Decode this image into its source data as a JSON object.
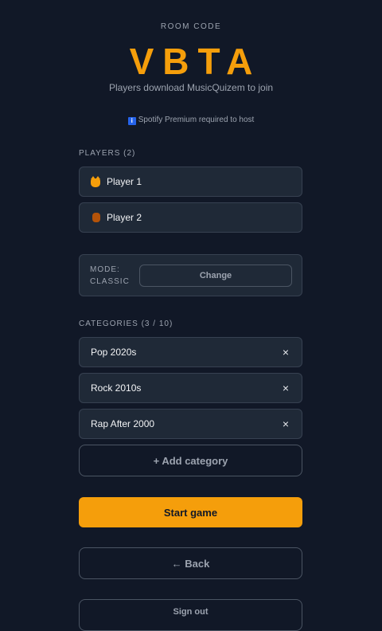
{
  "room": {
    "label": "ROOM CODE",
    "code": "VBTA",
    "join_hint": "Players download MusicQuizem to join",
    "spotify_note": "Spotify Premium required to host",
    "info_icon": "i"
  },
  "players": {
    "label": "PLAYERS (2)",
    "items": [
      {
        "icon": "cat-face-icon",
        "name": "Player 1"
      },
      {
        "icon": "bear-icon",
        "name": "Player 2"
      }
    ]
  },
  "mode": {
    "label_line1": "MODE:",
    "label_line2": "CLASSIC",
    "change_label": "Change"
  },
  "categories": {
    "label": "CATEGORIES (3 / 10)",
    "items": [
      {
        "name": "Pop 2020s"
      },
      {
        "name": "Rock 2010s"
      },
      {
        "name": "Rap After 2000"
      }
    ],
    "remove_glyph": "×",
    "add_label": "+ Add category"
  },
  "actions": {
    "start_label": "Start game",
    "back_label": "← Back",
    "signout_label": "Sign out"
  },
  "colors": {
    "background": "#111827",
    "accent": "#f59e0b",
    "card": "#1f2937",
    "border": "#374151"
  }
}
